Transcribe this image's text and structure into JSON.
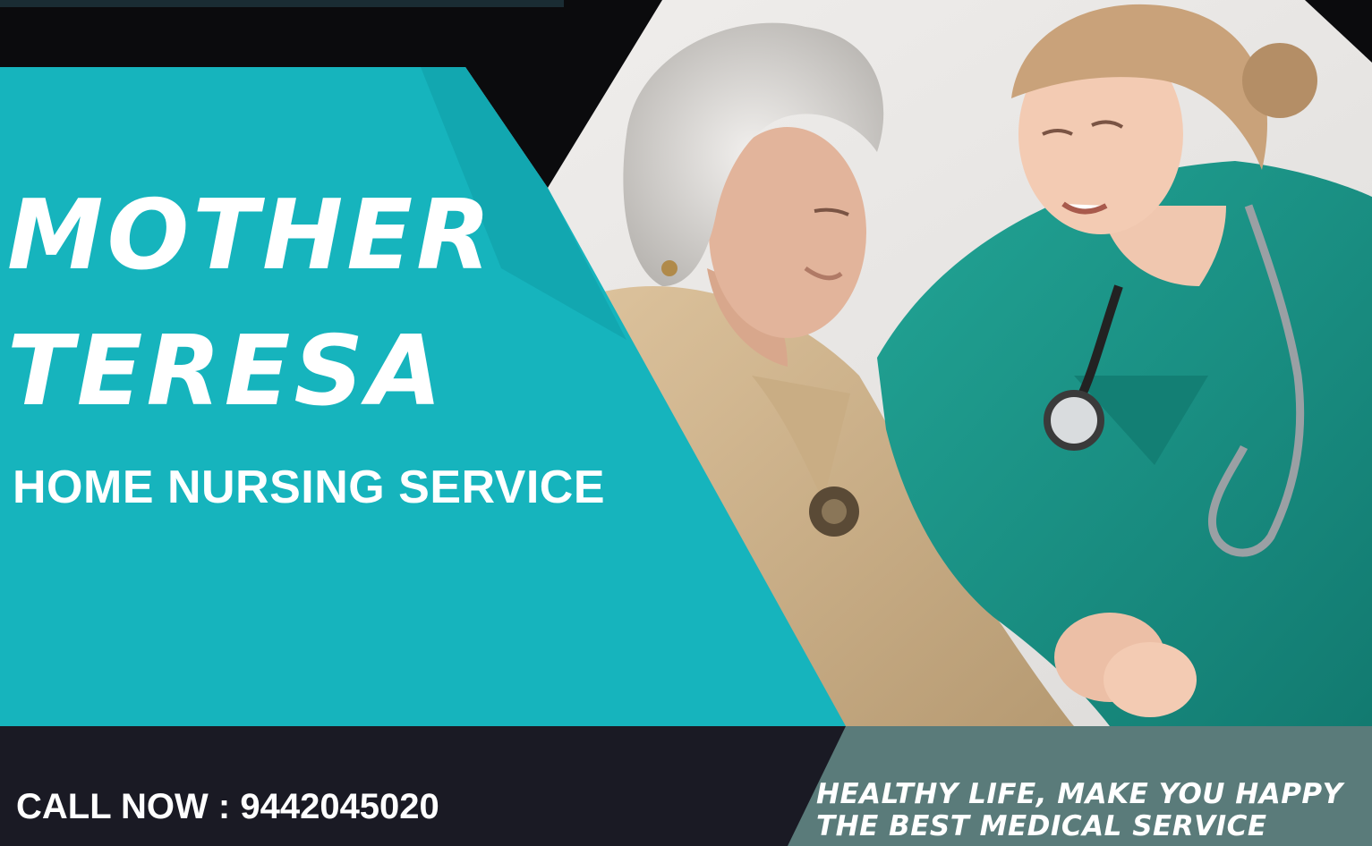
{
  "colors": {
    "teal": "#16b4bd",
    "teal_dark": "#0e9ea8",
    "navy": "#1a1a24",
    "slate": "#5a7b7a",
    "scrub": "#1f9a8e",
    "white": "#ffffff"
  },
  "title": {
    "line1": "MOTHER",
    "line2": "TERESA"
  },
  "subtitle": "HOME NURSING SERVICE",
  "contact": {
    "call_text": "CALL NOW : 9442045020"
  },
  "tagline": {
    "line1": "HEALTHY LIFE, MAKE YOU HAPPY",
    "line2": "THE BEST MEDICAL SERVICE"
  }
}
